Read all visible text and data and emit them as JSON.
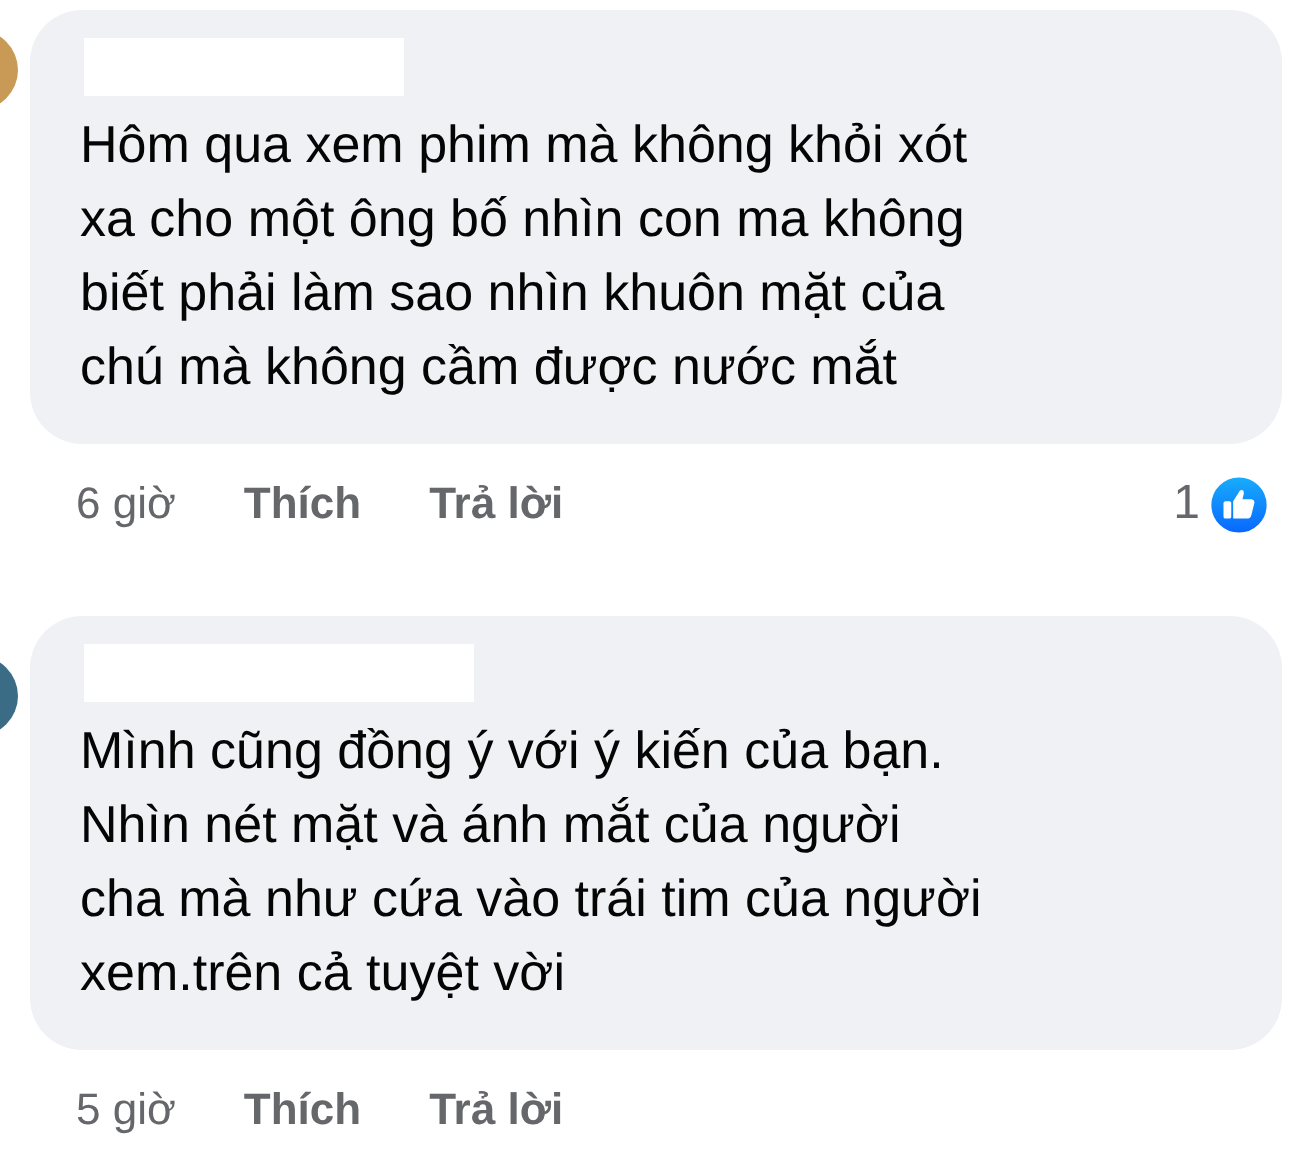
{
  "comments": [
    {
      "text": "Hôm qua xem phim mà không khỏi xót\nxa cho một ông bố nhìn con ma không\nbiết phải làm sao nhìn khuôn mặt của\nchú mà không cầm được nước mắt",
      "time": "6 giờ",
      "like_label": "Thích",
      "reply_label": "Trả lời",
      "reaction_count": "1"
    },
    {
      "text": "Mình cũng đồng ý với ý kiến của bạn.\nNhìn nét mặt và ánh mắt của người\ncha mà như cứa vào trái tim của người\nxem.trên cả tuyệt vời",
      "time": "5 giờ",
      "like_label": "Thích",
      "reply_label": "Trả lời"
    }
  ]
}
